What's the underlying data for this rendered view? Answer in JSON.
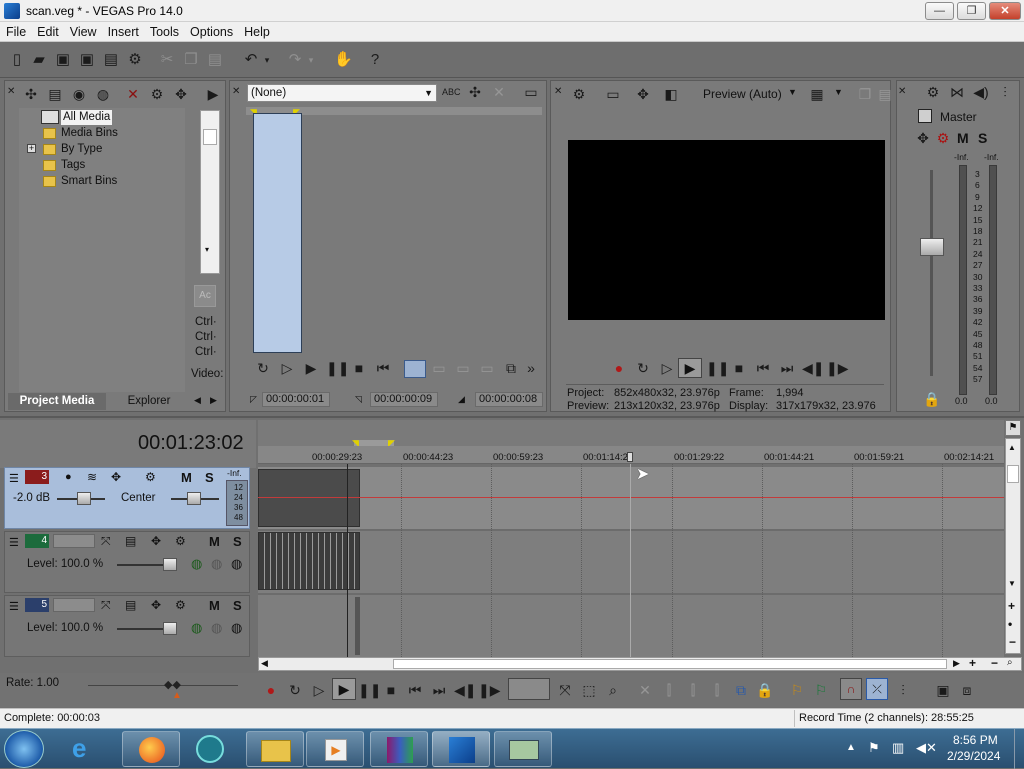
{
  "window": {
    "title": "scan.veg * - VEGAS Pro 14.0",
    "minimize": "—",
    "maximize": "❐",
    "close": "✕"
  },
  "menu": [
    "File",
    "Edit",
    "View",
    "Insert",
    "Tools",
    "Options",
    "Help"
  ],
  "project_media": {
    "tree": [
      "All Media",
      "Media Bins",
      "By Type",
      "Tags",
      "Smart Bins"
    ],
    "expander": "+",
    "side_labels": [
      "Ctrl·",
      "Ctrl·",
      "Ctrl·",
      "Video:"
    ],
    "tabs": [
      "Project Media",
      "Explorer"
    ]
  },
  "trimmer": {
    "dropdown_value": "(None)",
    "times": [
      "00:00:00:01",
      "00:00:00:09",
      "00:00:00:08"
    ]
  },
  "preview": {
    "quality": "Preview (Auto)",
    "project_label": "Project:",
    "project_value": "852x480x32, 23.976p",
    "preview_label": "Preview:",
    "preview_value": "213x120x32, 23.976p",
    "frame_label": "Frame:",
    "frame_value": "1,994",
    "display_label": "Display:",
    "display_value": "317x179x32, 23.976"
  },
  "mixer": {
    "title": "Master",
    "m": "M",
    "s": "S",
    "peak_left": "-Inf.",
    "peak_right": "-Inf.",
    "scale": [
      "3",
      "6",
      "9",
      "12",
      "15",
      "18",
      "21",
      "24",
      "27",
      "30",
      "33",
      "36",
      "39",
      "42",
      "45",
      "48",
      "51",
      "54",
      "57"
    ],
    "val_left": "0.0",
    "val_right": "0.0"
  },
  "timeline": {
    "timecode": "00:01:23:02",
    "ruler": [
      "00:00:29:23",
      "00:00:44:23",
      "00:00:59:23",
      "00:01:14:2",
      "00:01:29:22",
      "00:01:44:21",
      "00:01:59:21",
      "00:02:14:21"
    ],
    "tracks": [
      {
        "num": "3",
        "db": "-2.0 dB",
        "pan": "Center",
        "m": "M",
        "s": "S",
        "inf": "-Inf.",
        "meter": [
          "12",
          "24",
          "36",
          "48"
        ]
      },
      {
        "num": "4",
        "level": "Level: 100.0 %",
        "m": "M",
        "s": "S"
      },
      {
        "num": "5",
        "level": "Level: 100.0 %",
        "m": "M",
        "s": "S"
      }
    ]
  },
  "transport": {
    "rate": "Rate: 1.00"
  },
  "status": {
    "complete": "Complete: 00:00:03",
    "record_time": "Record Time (2 channels): 28:55:25"
  },
  "taskbar": {
    "time": "8:56 PM",
    "date": "2/29/2024"
  },
  "colors": {
    "track_selected": "#a9bedb",
    "playhead": "#c23b3b",
    "accent": "#2a7fd6"
  }
}
